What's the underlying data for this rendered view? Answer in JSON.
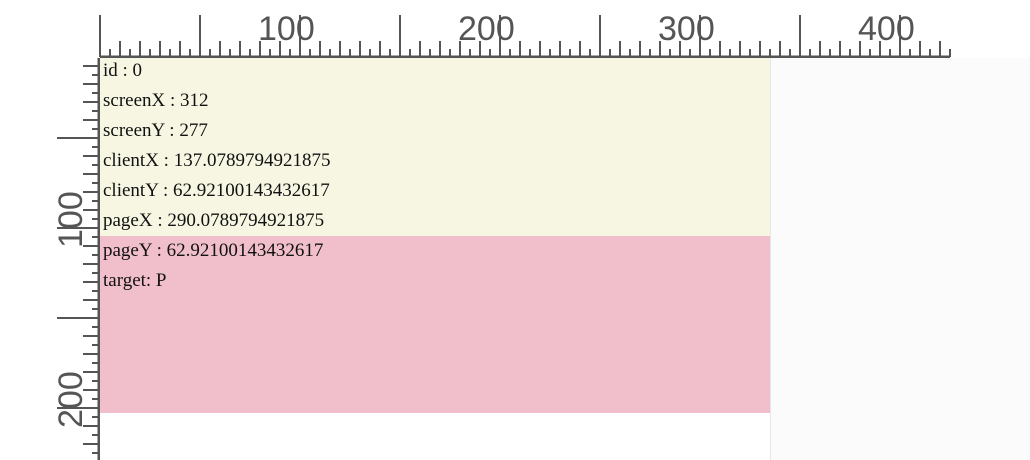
{
  "info_panel": {
    "lines": [
      "id : 0",
      "screenX : 312",
      "screenY : 277",
      "clientX : 137.0789794921875",
      "clientY : 62.92100143432617",
      "pageX : 290.0789794921875",
      "pageY : 62.92100143432617",
      "target: P"
    ]
  },
  "ruler": {
    "top_labels": [
      "100",
      "200",
      "300",
      "400"
    ],
    "left_labels": [
      "100",
      "200"
    ]
  },
  "colors": {
    "yellow_box": "#f6f6e2",
    "pink_box": "#f1bfcb",
    "ruler_ink": "#555555"
  }
}
